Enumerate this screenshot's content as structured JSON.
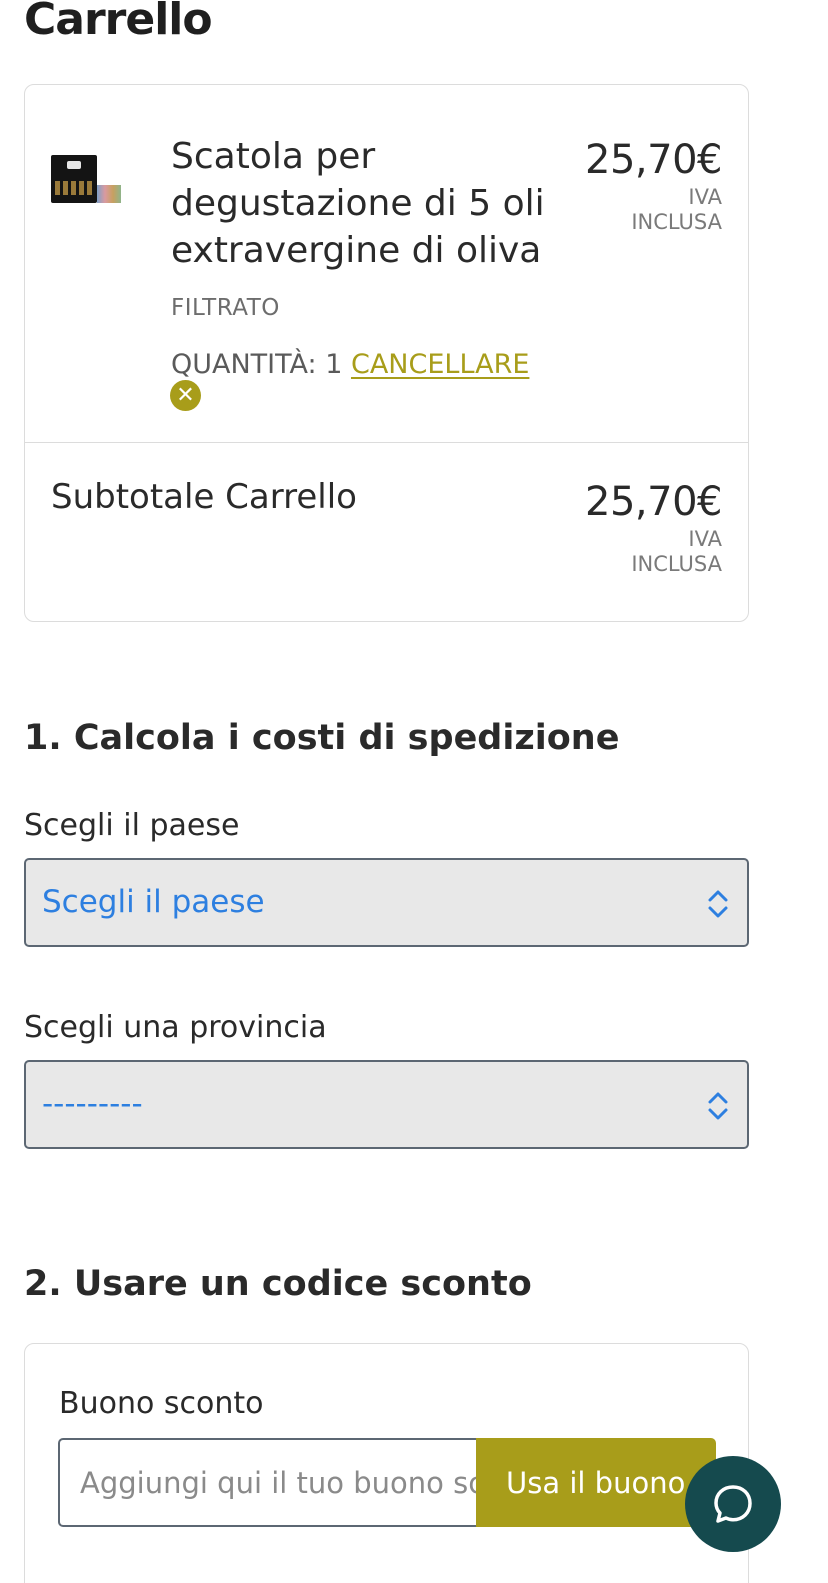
{
  "page": {
    "title": "Carrello"
  },
  "cart": {
    "item": {
      "name": "Scatola per degustazione di 5 oli extravergine di oliva",
      "variant": "FILTRATO",
      "quantity_label": "QUANTITÀ: 1",
      "remove_label": "CANCELLARE",
      "price": "25,70€",
      "vat_line1": "IVA",
      "vat_line2": "INCLUSA",
      "image_icon": "product-thumbnail"
    },
    "subtotal": {
      "label": "Subtotale Carrello",
      "price": "25,70€",
      "vat_line1": "IVA",
      "vat_line2": "INCLUSA"
    }
  },
  "shipping": {
    "title": "1. Calcola i costi di spedizione",
    "country_label": "Scegli il paese",
    "country_value": "Scegli il paese",
    "province_label": "Scegli una provincia",
    "province_value": "---------"
  },
  "discount": {
    "title": "2. Usare un codice sconto",
    "coupon_label": "Buono sconto",
    "coupon_placeholder": "Aggiungi qui il tuo buono sconto",
    "coupon_button": "Usa il buono"
  },
  "colors": {
    "accent": "#a89d1a",
    "link_blue": "#2d7fe0",
    "chat_bg": "#154a4e"
  },
  "icons": {
    "remove": "close-circle-icon",
    "select_arrow": "chevron-up-down-icon",
    "chat": "chat-bubble-icon"
  }
}
